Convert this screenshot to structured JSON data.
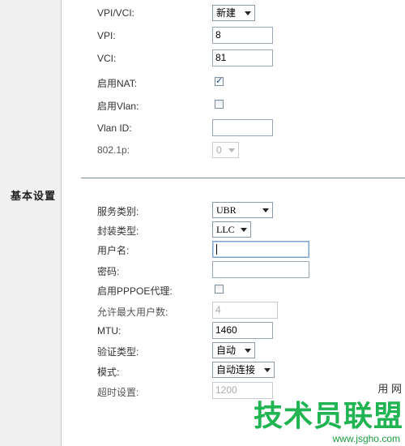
{
  "sidebar": {
    "section_label": "基本设置"
  },
  "form": {
    "vpi_vci": {
      "label": "VPI/VCI:",
      "value": "新建"
    },
    "vpi": {
      "label": "VPI:",
      "value": "8"
    },
    "vci": {
      "label": "VCI:",
      "value": "81"
    },
    "enable_nat": {
      "label": "启用NAT:",
      "checked": true
    },
    "enable_vlan": {
      "label": "启用Vlan:",
      "checked": false
    },
    "vlan_id": {
      "label": "Vlan ID:",
      "value": ""
    },
    "dot1p": {
      "label": "802.1p:",
      "value": "0"
    },
    "service_type": {
      "label": "服务类别:",
      "value": "UBR"
    },
    "encapsulation": {
      "label": "封装类型:",
      "value": "LLC"
    },
    "username": {
      "label": "用户名:",
      "value": ""
    },
    "password": {
      "label": "密码:",
      "value": ""
    },
    "pppoe_proxy": {
      "label": "启用PPPOE代理:",
      "checked": false
    },
    "max_users": {
      "label": "允许最大用户数:",
      "value": "4"
    },
    "mtu": {
      "label": "MTU:",
      "value": "1460"
    },
    "auth_type": {
      "label": "验证类型:",
      "value": "自动"
    },
    "mode": {
      "label": "模式:",
      "value": "自动连接"
    },
    "timeout": {
      "label": "超时设置:",
      "value": "1200"
    }
  },
  "watermark": {
    "text": "技术员联盟",
    "url": "www.jsgho.com",
    "tag": "用 网"
  }
}
